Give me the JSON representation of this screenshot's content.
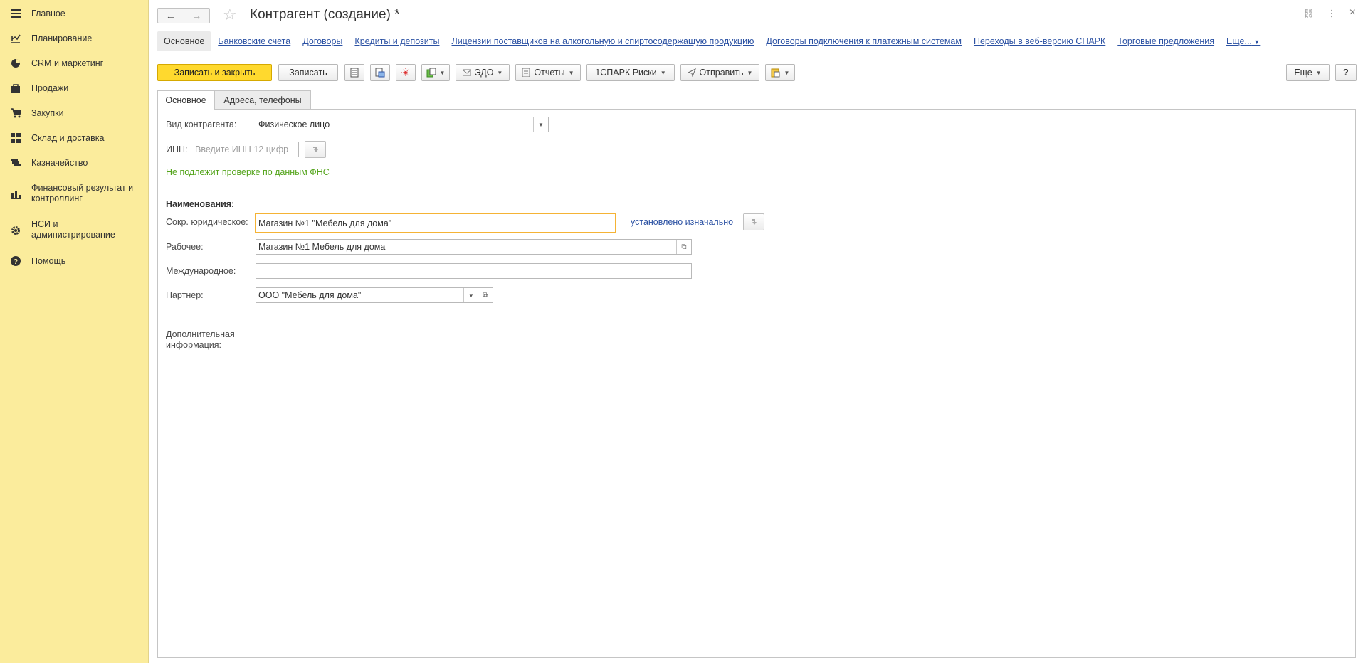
{
  "sidebar": {
    "items": [
      {
        "label": "Главное",
        "icon": "menu-icon"
      },
      {
        "label": "Планирование",
        "icon": "planning-icon"
      },
      {
        "label": "CRM и маркетинг",
        "icon": "pie-chart-icon"
      },
      {
        "label": "Продажи",
        "icon": "bag-icon"
      },
      {
        "label": "Закупки",
        "icon": "cart-icon"
      },
      {
        "label": "Склад и доставка",
        "icon": "warehouse-icon"
      },
      {
        "label": "Казначейство",
        "icon": "treasury-icon"
      },
      {
        "label": "Финансовый результат и контроллинг",
        "icon": "bar-chart-icon"
      },
      {
        "label": "НСИ и администрирование",
        "icon": "gear-icon"
      },
      {
        "label": "Помощь",
        "icon": "help-icon"
      }
    ]
  },
  "header": {
    "title": "Контрагент (создание) *",
    "back": "←",
    "forward": "→",
    "star": "☆",
    "link_icon": "⛓",
    "more_icon": "⋮",
    "close_icon": "×"
  },
  "sections": [
    {
      "label": "Основное",
      "active": true
    },
    {
      "label": "Банковские счета"
    },
    {
      "label": "Договоры"
    },
    {
      "label": "Кредиты и депозиты"
    },
    {
      "label": "Лицензии поставщиков на алкогольную и спиртосодержащую продукцию"
    },
    {
      "label": "Договоры подключения к платежным системам"
    },
    {
      "label": "Переходы в веб-версию СПАРК"
    },
    {
      "label": "Торговые предложения"
    },
    {
      "label": "Еще..."
    }
  ],
  "toolbar": {
    "save_close": "Записать и закрыть",
    "save": "Записать",
    "edo": "ЭДО",
    "reports": "Отчеты",
    "spark": "1СПАРК Риски",
    "send": "Отправить",
    "more": "Еще",
    "help": "?"
  },
  "tabs": {
    "main": "Основное",
    "addresses": "Адреса, телефоны"
  },
  "form": {
    "type_label": "Вид контрагента:",
    "type_value": "Физическое лицо",
    "inn_label": "ИНН:",
    "inn_placeholder": "Введите ИНН 12 цифр",
    "fns_link": "Не подлежит проверке по данным ФНС",
    "names_heading": "Наименования:",
    "short_label": "Сокр. юридическое:",
    "short_value": "Магазин №1 \"Мебель для дома\"",
    "short_status": "установлено изначально",
    "work_label": "Рабочее:",
    "work_value": "Магазин №1 Мебель для дома",
    "intl_label": "Международное:",
    "intl_value": "",
    "partner_label": "Партнер:",
    "partner_value": "ООО \"Мебель для дома\"",
    "extra_label": "Дополнительная информация:",
    "extra_value": ""
  }
}
